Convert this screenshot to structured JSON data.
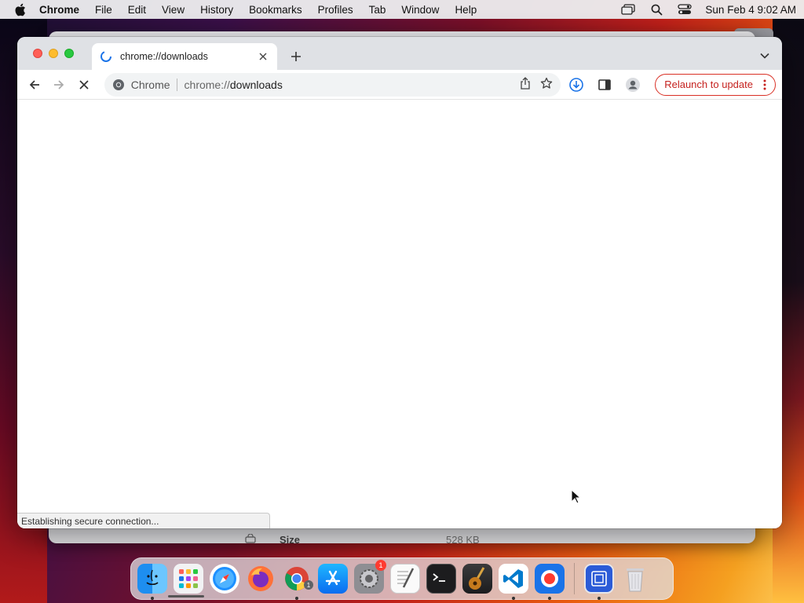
{
  "menubar": {
    "app_name": "Chrome",
    "items": [
      "File",
      "Edit",
      "View",
      "History",
      "Bookmarks",
      "Profiles",
      "Tab",
      "Window",
      "Help"
    ],
    "clock": "Sun Feb 4  9:02 AM"
  },
  "background_window": {
    "row_label": "Size",
    "row_value": "528 KB"
  },
  "chrome": {
    "tab": {
      "title": "chrome://downloads"
    },
    "omnibox": {
      "origin_label": "Chrome",
      "url_scheme": "chrome://",
      "url_host": "downloads"
    },
    "relaunch_label": "Relaunch to update",
    "status_text": "Establishing secure connection..."
  },
  "dock": {
    "items": [
      {
        "name": "Finder",
        "icon": "finder-icon"
      },
      {
        "name": "Launchpad",
        "icon": "launchpad-icon"
      },
      {
        "name": "Safari",
        "icon": "safari-icon"
      },
      {
        "name": "Firefox",
        "icon": "firefox-icon"
      },
      {
        "name": "Google Chrome",
        "icon": "chrome-icon",
        "badge": "1"
      },
      {
        "name": "App Store",
        "icon": "app-store-icon"
      },
      {
        "name": "System Settings",
        "icon": "system-settings-icon",
        "badge": "1"
      },
      {
        "name": "TextEdit",
        "icon": "textedit-icon"
      },
      {
        "name": "Terminal",
        "icon": "terminal-icon"
      },
      {
        "name": "GarageBand",
        "icon": "garageband-icon"
      },
      {
        "name": "Visual Studio Code",
        "icon": "vscode-icon"
      },
      {
        "name": "Screen Recorder",
        "icon": "screen-recorder-icon"
      },
      {
        "name": "Screenshot App",
        "icon": "screenshot-app-icon"
      },
      {
        "name": "Trash",
        "icon": "trash-icon"
      }
    ]
  },
  "colors": {
    "relaunch_red": "#c5221f",
    "chrome_blue": "#1a73e8",
    "tabstrip": "#dfe1e5"
  }
}
